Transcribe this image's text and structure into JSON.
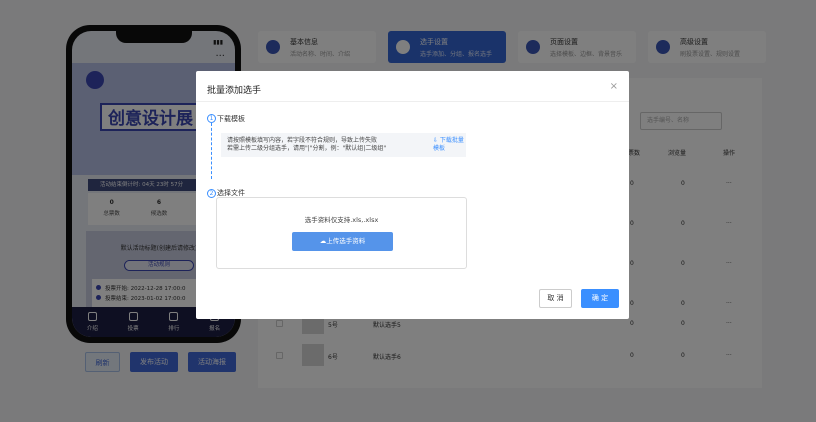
{
  "phone": {
    "status_signal": "▮▮▮",
    "menu_icon": "ellipsis-icon",
    "banner_title": "创意设计展",
    "countdown": "活动结束倒计时: 04天 23时 57分",
    "stats": [
      {
        "value": "0",
        "label": "总票数"
      },
      {
        "value": "6",
        "label": "候选数"
      },
      {
        "value": "0",
        "label": "访"
      }
    ],
    "card_title": "默认活动标题(创建后请修改)",
    "rules_label": "活动规则",
    "vote_start": "投票开始:  2022-12-28 17:00:0",
    "vote_end": "投票结束:  2023-01-02 17:00:0",
    "tabs": [
      "介绍",
      "投票",
      "排行",
      "报名"
    ]
  },
  "phone_buttons": {
    "refresh": "刷新",
    "publish": "发布活动",
    "poster": "活动海报"
  },
  "steps": [
    {
      "title": "基本信息",
      "desc": "活动名称、时间、介绍",
      "icon": "info-icon"
    },
    {
      "title": "选手设置",
      "desc": "选手添加、分组、报名选手",
      "icon": "user-icon"
    },
    {
      "title": "页面设置",
      "desc": "选择模板、边框、背景音乐",
      "icon": "page-icon"
    },
    {
      "title": "高级设置",
      "desc": "刷投票设置、规则设置",
      "icon": "gear-icon"
    }
  ],
  "table": {
    "search_placeholder": "选手编号、名称",
    "headers": [
      "票数",
      "浏览量",
      "操作"
    ],
    "rows": [
      {
        "no": "",
        "name": "",
        "votes": "0",
        "views": "0"
      },
      {
        "no": "",
        "name": "",
        "votes": "0",
        "views": "0"
      },
      {
        "no": "",
        "name": "",
        "votes": "0",
        "views": "0"
      },
      {
        "no": "",
        "name": "",
        "votes": "0",
        "views": "0"
      },
      {
        "no": "5号",
        "name": "默认选手5",
        "votes": "0",
        "views": "0"
      },
      {
        "no": "6号",
        "name": "默认选手6",
        "votes": "0",
        "views": "0"
      }
    ],
    "action": "···"
  },
  "modal": {
    "title": "批量添加选手",
    "close": "×",
    "step1_num": "1",
    "step1_label": "下载模板",
    "tip_line1": "请按照模板填写内容，若字段不符合规则，导致上传失败",
    "tip_line2": "若需上传二级分组选手，请用\"|\"分割，例：\"默认组|二级组\"",
    "tip_link": "⇩ 下载批量模板",
    "step2_num": "2",
    "step2_label": "选择文件",
    "upload_hint": "选手资料仅支持.xls,.xlsx",
    "upload_button": "☁上传选手资料",
    "cancel": "取 消",
    "confirm": "确 定"
  }
}
